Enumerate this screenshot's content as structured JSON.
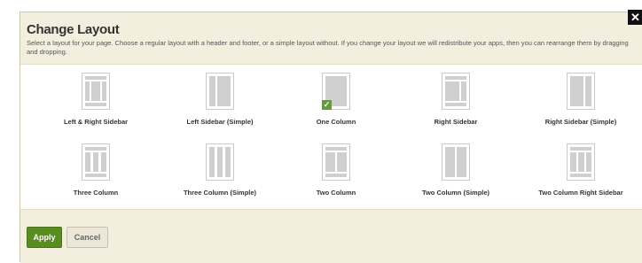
{
  "dialog": {
    "title": "Change Layout",
    "description": "Select a layout for your page. Choose a regular layout with a header and footer, or a simple layout without. If you change your layout we will redistribute your apps, then you can rearrange them by dragging and dropping.",
    "close_label": "✕"
  },
  "layouts": [
    {
      "label": "Left & Right Sidebar",
      "selected": false
    },
    {
      "label": "Left Sidebar (Simple)",
      "selected": false
    },
    {
      "label": "One Column",
      "selected": true
    },
    {
      "label": "Right Sidebar",
      "selected": false
    },
    {
      "label": "Right Sidebar (Simple)",
      "selected": false
    },
    {
      "label": "Three Column",
      "selected": false
    },
    {
      "label": "Three Column (Simple)",
      "selected": false
    },
    {
      "label": "Two Column",
      "selected": false
    },
    {
      "label": "Two Column (Simple)",
      "selected": false
    },
    {
      "label": "Two Column Right Sidebar",
      "selected": false
    }
  ],
  "footer": {
    "apply_label": "Apply",
    "cancel_label": "Cancel"
  },
  "colors": {
    "accent": "#5a8d1f",
    "panel": "#f3efdf",
    "checkmark": "#5e9e33"
  }
}
